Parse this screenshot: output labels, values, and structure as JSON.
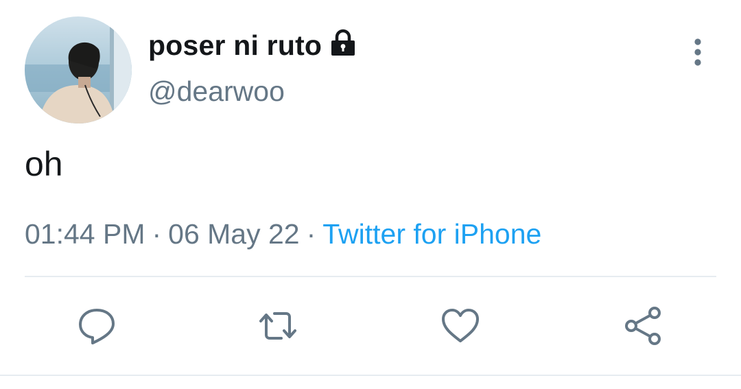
{
  "tweet": {
    "display_name": "poser ni ruto",
    "handle": "@dearwoo",
    "text": "oh",
    "time": "01:44 PM",
    "separator": "·",
    "date": "06 May 22",
    "source": "Twitter for iPhone",
    "protected_icon": "lock-icon",
    "more_icon": "vertical-ellipsis-icon"
  },
  "actions": [
    {
      "icon": "reply-icon"
    },
    {
      "icon": "retweet-icon"
    },
    {
      "icon": "like-icon"
    },
    {
      "icon": "share-icon"
    }
  ],
  "colors": {
    "text": "#14171a",
    "secondary": "#657786",
    "link": "#1da1f2",
    "divider": "#e6ecf0"
  }
}
